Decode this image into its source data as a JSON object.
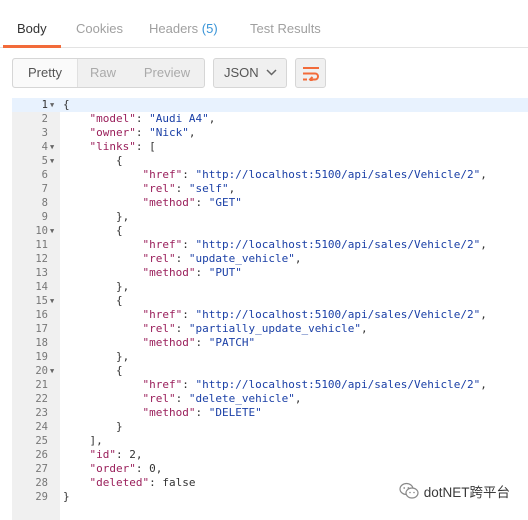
{
  "tabs": [
    {
      "label": "Body",
      "active": true
    },
    {
      "label": "Cookies",
      "active": false
    },
    {
      "label": "Headers",
      "count": "(5)",
      "active": false
    },
    {
      "label": "Test Results",
      "active": false
    }
  ],
  "toolbar": {
    "views": [
      "Pretty",
      "Raw",
      "Preview"
    ],
    "active_view": "Pretty",
    "format": "JSON",
    "format_icon": "chevron-down-icon",
    "wrap_icon": "wrap-lines-icon"
  },
  "colors": {
    "accent": "#f26b3a",
    "key": "#9a1f5b",
    "string": "#1a3fa6",
    "count": "#3a95d8"
  },
  "editor": {
    "lines": [
      {
        "n": "1",
        "fold": true,
        "code": "{"
      },
      {
        "n": "2",
        "code": "    \"model\": \"Audi A4\","
      },
      {
        "n": "3",
        "code": "    \"owner\": \"Nick\","
      },
      {
        "n": "4",
        "fold": true,
        "code": "    \"links\": ["
      },
      {
        "n": "5",
        "fold": true,
        "code": "        {"
      },
      {
        "n": "6",
        "code": "            \"href\": \"http://localhost:5100/api/sales/Vehicle/2\","
      },
      {
        "n": "7",
        "code": "            \"rel\": \"self\","
      },
      {
        "n": "8",
        "code": "            \"method\": \"GET\""
      },
      {
        "n": "9",
        "code": "        },"
      },
      {
        "n": "10",
        "fold": true,
        "code": "        {"
      },
      {
        "n": "11",
        "code": "            \"href\": \"http://localhost:5100/api/sales/Vehicle/2\","
      },
      {
        "n": "12",
        "code": "            \"rel\": \"update_vehicle\","
      },
      {
        "n": "13",
        "code": "            \"method\": \"PUT\""
      },
      {
        "n": "14",
        "code": "        },"
      },
      {
        "n": "15",
        "fold": true,
        "code": "        {"
      },
      {
        "n": "16",
        "code": "            \"href\": \"http://localhost:5100/api/sales/Vehicle/2\","
      },
      {
        "n": "17",
        "code": "            \"rel\": \"partially_update_vehicle\","
      },
      {
        "n": "18",
        "code": "            \"method\": \"PATCH\""
      },
      {
        "n": "19",
        "code": "        },"
      },
      {
        "n": "20",
        "fold": true,
        "code": "        {"
      },
      {
        "n": "21",
        "code": "            \"href\": \"http://localhost:5100/api/sales/Vehicle/2\","
      },
      {
        "n": "22",
        "code": "            \"rel\": \"delete_vehicle\","
      },
      {
        "n": "23",
        "code": "            \"method\": \"DELETE\""
      },
      {
        "n": "24",
        "code": "        }"
      },
      {
        "n": "25",
        "code": "    ],"
      },
      {
        "n": "26",
        "code": "    \"id\": 2,"
      },
      {
        "n": "27",
        "code": "    \"order\": 0,"
      },
      {
        "n": "28",
        "code": "    \"deleted\": false"
      },
      {
        "n": "29",
        "code": "}"
      }
    ]
  },
  "watermark": {
    "text": "dotNET跨平台",
    "icon": "wechat-icon"
  }
}
